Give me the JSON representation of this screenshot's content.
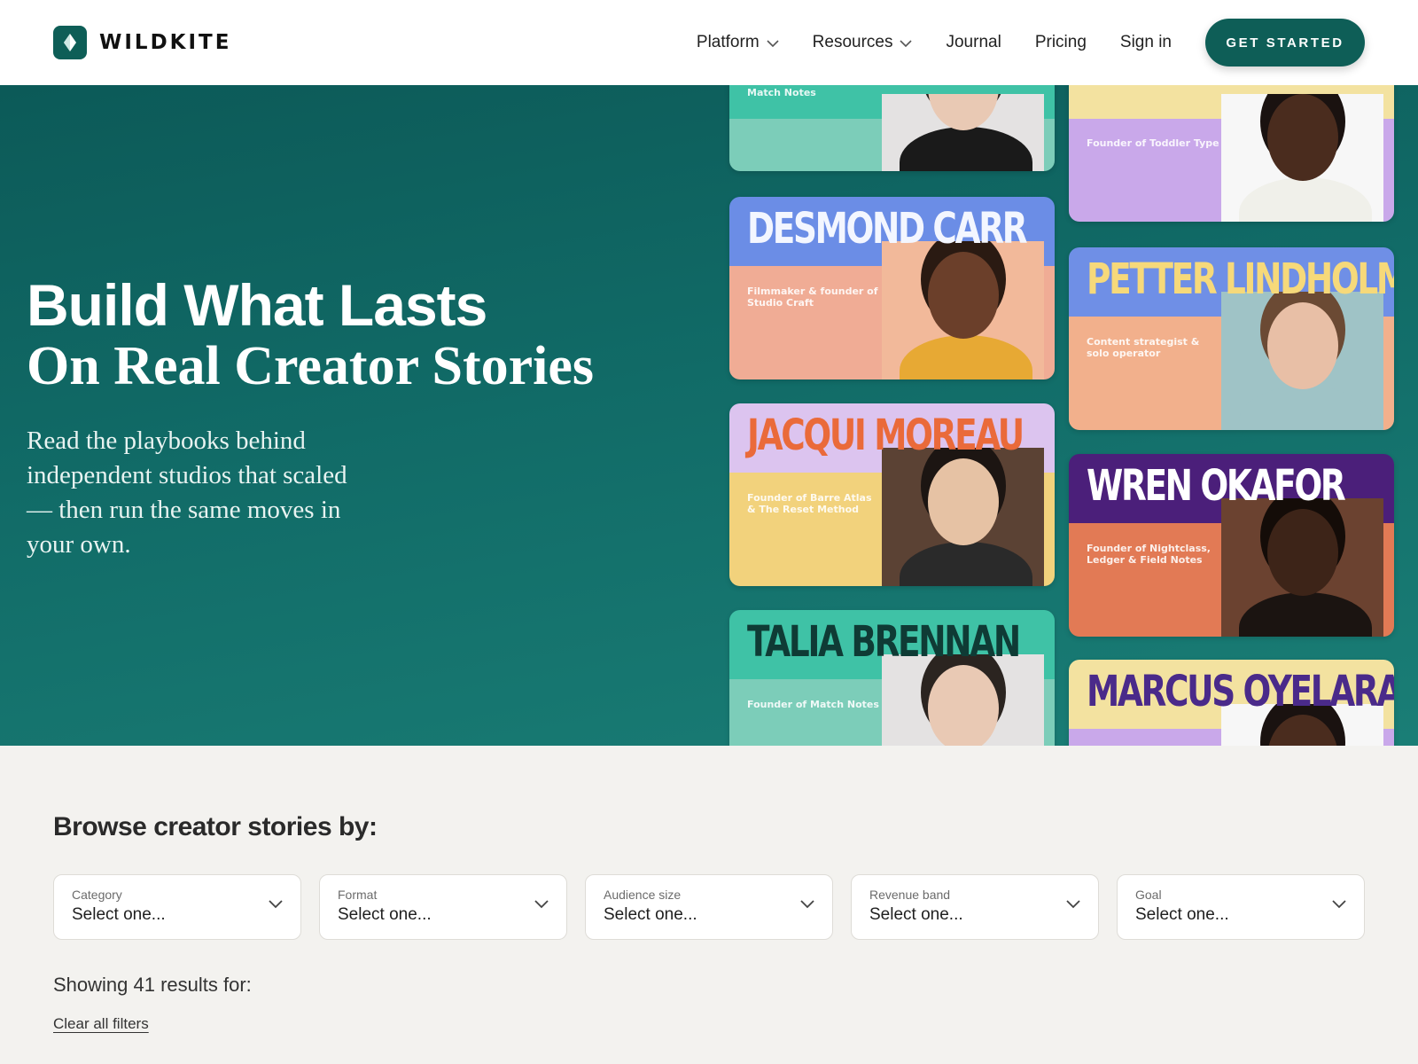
{
  "brand": {
    "name": "WILDKITE",
    "accent": "#0e5e57"
  },
  "nav": {
    "items": [
      {
        "label": "Platform",
        "has_dropdown": true
      },
      {
        "label": "Resources",
        "has_dropdown": true
      },
      {
        "label": "Journal",
        "has_dropdown": false
      },
      {
        "label": "Pricing",
        "has_dropdown": false
      },
      {
        "label": "Sign in",
        "has_dropdown": false
      }
    ],
    "cta": "GET STARTED"
  },
  "hero": {
    "title": "Build What Lasts",
    "subtitle": "On Real Creator Stories",
    "body": "Read the playbooks behind independent studios that scaled — then run the same moves in your own."
  },
  "cards": {
    "left": [
      {
        "name": "",
        "desc": "Match Notes",
        "band": "#3fc2a6",
        "body": "#7ccdb9",
        "name_color": "#0f3b35",
        "photo_bg": "#e4e2e2",
        "skin": "#e9c9b4",
        "hair": "#2b2420",
        "shirt": "#1a1a1a"
      },
      {
        "name": "DESMOND CARR",
        "desc": "Filmmaker & founder of Studio Craft",
        "band": "#6b8de6",
        "body": "#f0ac95",
        "name_color": "#f3f6ff",
        "photo_bg": "#f2b99a",
        "skin": "#6b3f2a",
        "hair": "#2a1a12",
        "shirt": "#e7a934"
      },
      {
        "name": "JACQUI MOREAU",
        "desc": "Founder of Barre Atlas & The Reset Method",
        "band": "#dcc4ef",
        "body": "#f2d27c",
        "name_color": "#ea6a3a",
        "photo_bg": "#5b4234",
        "skin": "#e6c2a4",
        "hair": "#1c1512",
        "shirt": "#2a2a2a"
      },
      {
        "name": "TALIA BRENNAN",
        "desc": "Founder of Match Notes",
        "band": "#3fc2a6",
        "body": "#7ccdb9",
        "name_color": "#0f3b35",
        "photo_bg": "#e4e2e2",
        "skin": "#e9c9b4",
        "hair": "#2b2420",
        "shirt": "#1a1a1a"
      }
    ],
    "right": [
      {
        "name": "",
        "desc": "Founder of Toddler Type",
        "band": "#f3e2a0",
        "body": "#c9a8ea",
        "name_color": "#4a2a8a",
        "photo_bg": "#f7f7f7",
        "skin": "#4a2c1e",
        "hair": "#1a1210",
        "shirt": "#f0f0ea"
      },
      {
        "name": "PETTER LINDHOLM",
        "desc": "Content strategist & solo operator",
        "band": "#6f8fe6",
        "body": "#f2b08c",
        "name_color": "#f6d97a",
        "photo_bg": "#9fc3c6",
        "skin": "#e8bfa6",
        "hair": "#6b4a34",
        "shirt": "#9fc3c6"
      },
      {
        "name": "WREN OKAFOR",
        "desc": "Founder of Nightclass, Ledger & Field Notes",
        "band": "#4b1f7a",
        "body": "#e27a55",
        "name_color": "#ffffff",
        "photo_bg": "#6b4230",
        "skin": "#3d2418",
        "hair": "#140c08",
        "shirt": "#1b1411"
      },
      {
        "name": "MARCUS OYELARAN",
        "desc": "",
        "band": "#f3e2a0",
        "body": "#c9a8ea",
        "name_color": "#4a2a8a",
        "photo_bg": "#f7f7f7",
        "skin": "#4a2c1e",
        "hair": "#1a1210",
        "shirt": "#f0f0ea"
      }
    ]
  },
  "browse": {
    "title": "Browse creator stories by:",
    "filters": [
      {
        "label": "Category",
        "value": "Select one..."
      },
      {
        "label": "Format",
        "value": "Select one..."
      },
      {
        "label": "Audience size",
        "value": "Select one..."
      },
      {
        "label": "Revenue band",
        "value": "Select one..."
      },
      {
        "label": "Goal",
        "value": "Select one..."
      }
    ],
    "results_text": "Showing 41 results for:",
    "clear_label": "Clear all filters"
  }
}
